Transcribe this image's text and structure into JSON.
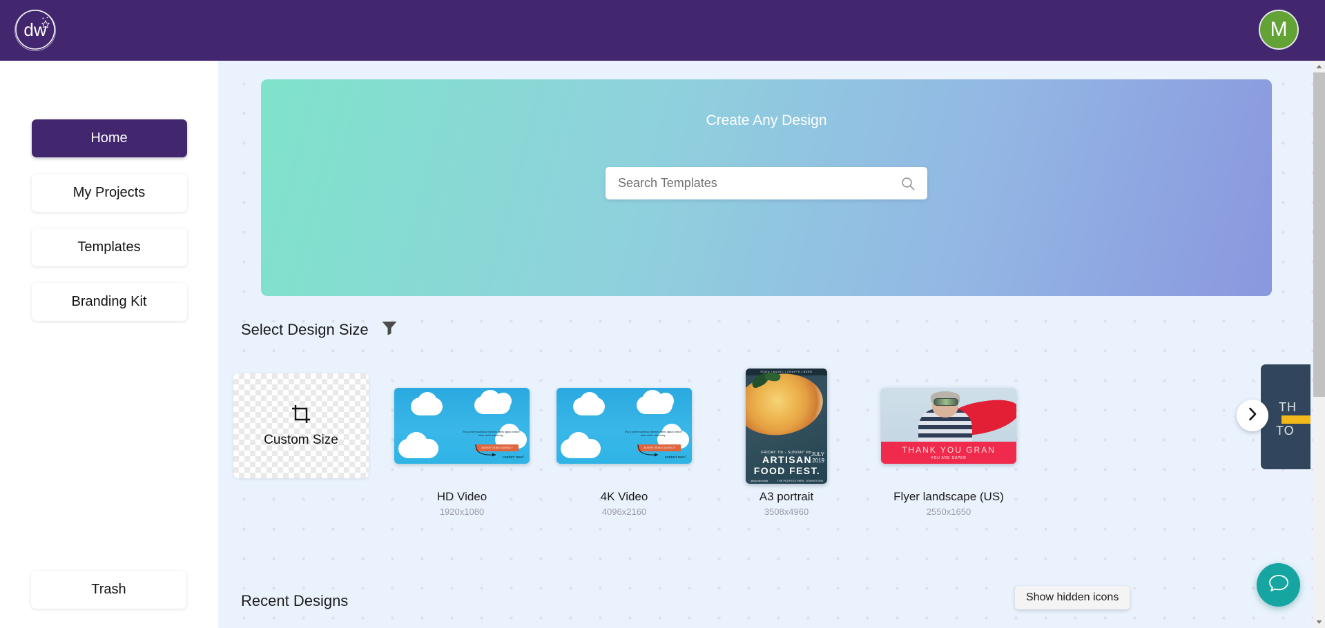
{
  "app": {
    "brand_mark": "dw",
    "topbar_color": "#42276e",
    "accent_color": "#42276e",
    "canvas_color": "#eaf3fd",
    "chat_color": "#16a5a0",
    "avatar_color": "#63a235"
  },
  "topbar": {
    "logo_text": "dw",
    "logo_icon": "dw-circle-logo",
    "avatar_initial": "M",
    "avatar_icon": "user-avatar"
  },
  "sidebar": {
    "items": [
      {
        "label": "Home",
        "active": true
      },
      {
        "label": "My Projects",
        "active": false
      },
      {
        "label": "Templates",
        "active": false
      },
      {
        "label": "Branding Kit",
        "active": false
      }
    ],
    "trash": {
      "label": "Trash"
    }
  },
  "hero": {
    "title": "Create Any Design",
    "search": {
      "placeholder": "Search Templates",
      "value": "",
      "icon": "search-icon"
    }
  },
  "sections": {
    "design_size": {
      "title": "Select Design Size",
      "filter_icon": "filter-funnel-icon"
    },
    "recent_designs": {
      "title": "Recent Designs"
    }
  },
  "design_sizes": [
    {
      "title": "Custom Size",
      "dims": "",
      "kind": "custom",
      "icon": "crop-icon"
    },
    {
      "title": "HD Video",
      "dims": "1920x1080",
      "kind": "video"
    },
    {
      "title": "4K Video",
      "dims": "4096x2160",
      "kind": "video"
    },
    {
      "title": "A3 portrait",
      "dims": "3508x4960",
      "kind": "poster"
    },
    {
      "title": "Flyer landscape (US)",
      "dims": "2550x1650",
      "kind": "flyer"
    }
  ],
  "thumb_art": {
    "video": {
      "body_text": "This is where traditional elements meets digital creative ideas meets advertising.",
      "button_label": "ADVERTISING AGENCY",
      "cta": "contact now!"
    },
    "poster": {
      "top_strip": "FOOD | MUSIC | CRAFTS | BEER",
      "dates": "FRIDAY 7th - SUNDAY 9th.",
      "month": "JULY",
      "year": "2019",
      "line1": "ARTISAN",
      "line2": "FOOD FEST.",
      "handle": "@socialmedia",
      "venue": "THE PEOPLES PARK, DOWNTOWN."
    },
    "flyer": {
      "headline": "THANK YOU GRAN",
      "subline": "YOU ARE SUPER"
    },
    "partial_card": {
      "line1": "TH",
      "line2": "TO"
    }
  },
  "carousel": {
    "next_icon": "chevron-right-icon",
    "next_label": "Next"
  },
  "tooltip": {
    "text": "Show hidden icons"
  },
  "chat": {
    "icon": "chat-bubble-icon",
    "label": "Chat"
  },
  "scrollbar": {
    "up_icon": "scroll-up-arrow",
    "down_icon": "scroll-down-arrow"
  }
}
